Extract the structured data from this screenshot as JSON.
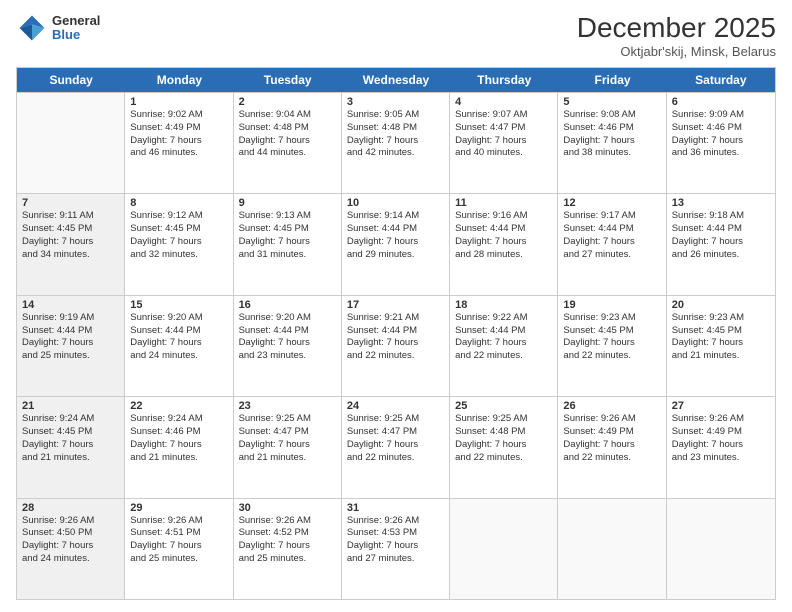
{
  "logo": {
    "general": "General",
    "blue": "Blue"
  },
  "header": {
    "month": "December 2025",
    "location": "Oktjabr'skij, Minsk, Belarus"
  },
  "weekdays": [
    "Sunday",
    "Monday",
    "Tuesday",
    "Wednesday",
    "Thursday",
    "Friday",
    "Saturday"
  ],
  "rows": [
    [
      {
        "day": "",
        "lines": [],
        "empty": true,
        "shaded": false
      },
      {
        "day": "1",
        "lines": [
          "Sunrise: 9:02 AM",
          "Sunset: 4:49 PM",
          "Daylight: 7 hours",
          "and 46 minutes."
        ],
        "empty": false,
        "shaded": false
      },
      {
        "day": "2",
        "lines": [
          "Sunrise: 9:04 AM",
          "Sunset: 4:48 PM",
          "Daylight: 7 hours",
          "and 44 minutes."
        ],
        "empty": false,
        "shaded": false
      },
      {
        "day": "3",
        "lines": [
          "Sunrise: 9:05 AM",
          "Sunset: 4:48 PM",
          "Daylight: 7 hours",
          "and 42 minutes."
        ],
        "empty": false,
        "shaded": false
      },
      {
        "day": "4",
        "lines": [
          "Sunrise: 9:07 AM",
          "Sunset: 4:47 PM",
          "Daylight: 7 hours",
          "and 40 minutes."
        ],
        "empty": false,
        "shaded": false
      },
      {
        "day": "5",
        "lines": [
          "Sunrise: 9:08 AM",
          "Sunset: 4:46 PM",
          "Daylight: 7 hours",
          "and 38 minutes."
        ],
        "empty": false,
        "shaded": false
      },
      {
        "day": "6",
        "lines": [
          "Sunrise: 9:09 AM",
          "Sunset: 4:46 PM",
          "Daylight: 7 hours",
          "and 36 minutes."
        ],
        "empty": false,
        "shaded": false
      }
    ],
    [
      {
        "day": "7",
        "lines": [
          "Sunrise: 9:11 AM",
          "Sunset: 4:45 PM",
          "Daylight: 7 hours",
          "and 34 minutes."
        ],
        "empty": false,
        "shaded": true
      },
      {
        "day": "8",
        "lines": [
          "Sunrise: 9:12 AM",
          "Sunset: 4:45 PM",
          "Daylight: 7 hours",
          "and 32 minutes."
        ],
        "empty": false,
        "shaded": false
      },
      {
        "day": "9",
        "lines": [
          "Sunrise: 9:13 AM",
          "Sunset: 4:45 PM",
          "Daylight: 7 hours",
          "and 31 minutes."
        ],
        "empty": false,
        "shaded": false
      },
      {
        "day": "10",
        "lines": [
          "Sunrise: 9:14 AM",
          "Sunset: 4:44 PM",
          "Daylight: 7 hours",
          "and 29 minutes."
        ],
        "empty": false,
        "shaded": false
      },
      {
        "day": "11",
        "lines": [
          "Sunrise: 9:16 AM",
          "Sunset: 4:44 PM",
          "Daylight: 7 hours",
          "and 28 minutes."
        ],
        "empty": false,
        "shaded": false
      },
      {
        "day": "12",
        "lines": [
          "Sunrise: 9:17 AM",
          "Sunset: 4:44 PM",
          "Daylight: 7 hours",
          "and 27 minutes."
        ],
        "empty": false,
        "shaded": false
      },
      {
        "day": "13",
        "lines": [
          "Sunrise: 9:18 AM",
          "Sunset: 4:44 PM",
          "Daylight: 7 hours",
          "and 26 minutes."
        ],
        "empty": false,
        "shaded": false
      }
    ],
    [
      {
        "day": "14",
        "lines": [
          "Sunrise: 9:19 AM",
          "Sunset: 4:44 PM",
          "Daylight: 7 hours",
          "and 25 minutes."
        ],
        "empty": false,
        "shaded": true
      },
      {
        "day": "15",
        "lines": [
          "Sunrise: 9:20 AM",
          "Sunset: 4:44 PM",
          "Daylight: 7 hours",
          "and 24 minutes."
        ],
        "empty": false,
        "shaded": false
      },
      {
        "day": "16",
        "lines": [
          "Sunrise: 9:20 AM",
          "Sunset: 4:44 PM",
          "Daylight: 7 hours",
          "and 23 minutes."
        ],
        "empty": false,
        "shaded": false
      },
      {
        "day": "17",
        "lines": [
          "Sunrise: 9:21 AM",
          "Sunset: 4:44 PM",
          "Daylight: 7 hours",
          "and 22 minutes."
        ],
        "empty": false,
        "shaded": false
      },
      {
        "day": "18",
        "lines": [
          "Sunrise: 9:22 AM",
          "Sunset: 4:44 PM",
          "Daylight: 7 hours",
          "and 22 minutes."
        ],
        "empty": false,
        "shaded": false
      },
      {
        "day": "19",
        "lines": [
          "Sunrise: 9:23 AM",
          "Sunset: 4:45 PM",
          "Daylight: 7 hours",
          "and 22 minutes."
        ],
        "empty": false,
        "shaded": false
      },
      {
        "day": "20",
        "lines": [
          "Sunrise: 9:23 AM",
          "Sunset: 4:45 PM",
          "Daylight: 7 hours",
          "and 21 minutes."
        ],
        "empty": false,
        "shaded": false
      }
    ],
    [
      {
        "day": "21",
        "lines": [
          "Sunrise: 9:24 AM",
          "Sunset: 4:45 PM",
          "Daylight: 7 hours",
          "and 21 minutes."
        ],
        "empty": false,
        "shaded": true
      },
      {
        "day": "22",
        "lines": [
          "Sunrise: 9:24 AM",
          "Sunset: 4:46 PM",
          "Daylight: 7 hours",
          "and 21 minutes."
        ],
        "empty": false,
        "shaded": false
      },
      {
        "day": "23",
        "lines": [
          "Sunrise: 9:25 AM",
          "Sunset: 4:47 PM",
          "Daylight: 7 hours",
          "and 21 minutes."
        ],
        "empty": false,
        "shaded": false
      },
      {
        "day": "24",
        "lines": [
          "Sunrise: 9:25 AM",
          "Sunset: 4:47 PM",
          "Daylight: 7 hours",
          "and 22 minutes."
        ],
        "empty": false,
        "shaded": false
      },
      {
        "day": "25",
        "lines": [
          "Sunrise: 9:25 AM",
          "Sunset: 4:48 PM",
          "Daylight: 7 hours",
          "and 22 minutes."
        ],
        "empty": false,
        "shaded": false
      },
      {
        "day": "26",
        "lines": [
          "Sunrise: 9:26 AM",
          "Sunset: 4:49 PM",
          "Daylight: 7 hours",
          "and 22 minutes."
        ],
        "empty": false,
        "shaded": false
      },
      {
        "day": "27",
        "lines": [
          "Sunrise: 9:26 AM",
          "Sunset: 4:49 PM",
          "Daylight: 7 hours",
          "and 23 minutes."
        ],
        "empty": false,
        "shaded": false
      }
    ],
    [
      {
        "day": "28",
        "lines": [
          "Sunrise: 9:26 AM",
          "Sunset: 4:50 PM",
          "Daylight: 7 hours",
          "and 24 minutes."
        ],
        "empty": false,
        "shaded": true
      },
      {
        "day": "29",
        "lines": [
          "Sunrise: 9:26 AM",
          "Sunset: 4:51 PM",
          "Daylight: 7 hours",
          "and 25 minutes."
        ],
        "empty": false,
        "shaded": false
      },
      {
        "day": "30",
        "lines": [
          "Sunrise: 9:26 AM",
          "Sunset: 4:52 PM",
          "Daylight: 7 hours",
          "and 25 minutes."
        ],
        "empty": false,
        "shaded": false
      },
      {
        "day": "31",
        "lines": [
          "Sunrise: 9:26 AM",
          "Sunset: 4:53 PM",
          "Daylight: 7 hours",
          "and 27 minutes."
        ],
        "empty": false,
        "shaded": false
      },
      {
        "day": "",
        "lines": [],
        "empty": true,
        "shaded": false
      },
      {
        "day": "",
        "lines": [],
        "empty": true,
        "shaded": false
      },
      {
        "day": "",
        "lines": [],
        "empty": true,
        "shaded": false
      }
    ]
  ]
}
